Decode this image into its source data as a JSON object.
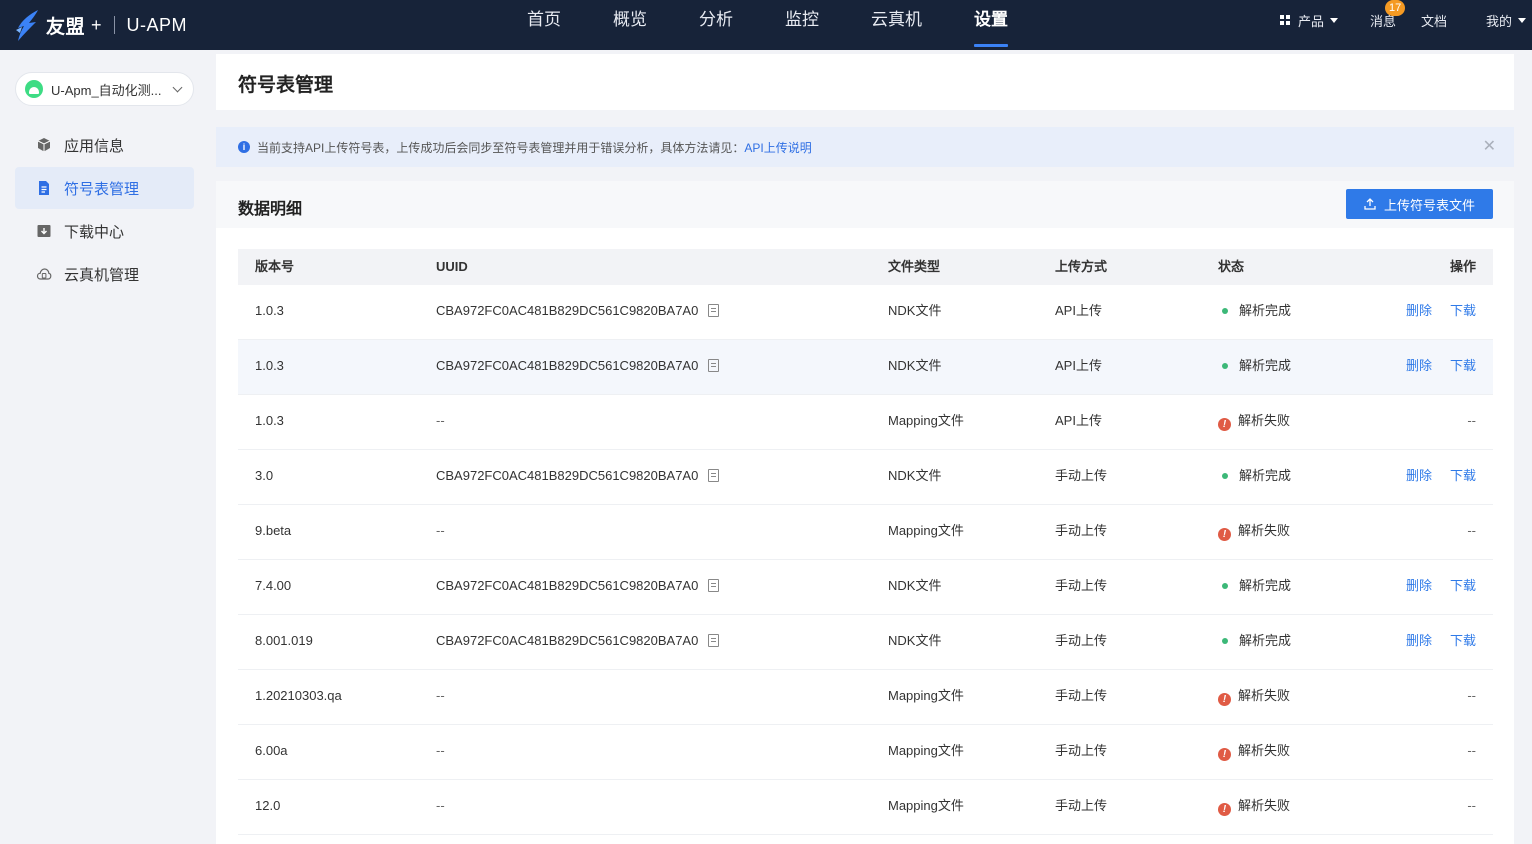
{
  "topnav": {
    "brand": "友盟",
    "brand_plus": "+",
    "product": "U-APM",
    "tabs": [
      "首页",
      "概览",
      "分析",
      "监控",
      "云真机",
      "设置"
    ],
    "active_tab": "设置",
    "right": {
      "products_label": "产品",
      "messages_label": "消息",
      "messages_badge": "17",
      "docs_label": "文档",
      "me_label": "我的"
    }
  },
  "sidebar": {
    "app_name": "U-Apm_自动化测...",
    "items": [
      {
        "label": "应用信息",
        "icon": "cube-icon"
      },
      {
        "label": "符号表管理",
        "icon": "document-icon"
      },
      {
        "label": "下载中心",
        "icon": "download-icon"
      },
      {
        "label": "云真机管理",
        "icon": "cloud-icon"
      }
    ],
    "active_index": 1
  },
  "page": {
    "title": "符号表管理",
    "banner_text": "当前支持API上传符号表，上传成功后会同步至符号表管理并用于错误分析，具体方法请见：",
    "banner_link": "API上传说明",
    "section_title": "数据明细",
    "upload_button": "上传符号表文件"
  },
  "table": {
    "headers": [
      "版本号",
      "UUID",
      "文件类型",
      "上传方式",
      "状态",
      "操作"
    ],
    "delete_label": "删除",
    "download_label": "下载",
    "rows": [
      {
        "version": "1.0.3",
        "uuid": "CBA972FC0AC481B829DC561C9820BA7A0",
        "type": "NDK文件",
        "method": "API上传",
        "status": "解析完成",
        "ok": true
      },
      {
        "version": "1.0.3",
        "uuid": "CBA972FC0AC481B829DC561C9820BA7A0",
        "type": "NDK文件",
        "method": "API上传",
        "status": "解析完成",
        "ok": true
      },
      {
        "version": "1.0.3",
        "uuid": "--",
        "type": "Mapping文件",
        "method": "API上传",
        "status": "解析失败",
        "ok": false
      },
      {
        "version": "3.0",
        "uuid": "CBA972FC0AC481B829DC561C9820BA7A0",
        "type": "NDK文件",
        "method": "手动上传",
        "status": "解析完成",
        "ok": true
      },
      {
        "version": "9.beta",
        "uuid": "--",
        "type": "Mapping文件",
        "method": "手动上传",
        "status": "解析失败",
        "ok": false
      },
      {
        "version": "7.4.00",
        "uuid": "CBA972FC0AC481B829DC561C9820BA7A0",
        "type": "NDK文件",
        "method": "手动上传",
        "status": "解析完成",
        "ok": true
      },
      {
        "version": "8.001.019",
        "uuid": "CBA972FC0AC481B829DC561C9820BA7A0",
        "type": "NDK文件",
        "method": "手动上传",
        "status": "解析完成",
        "ok": true
      },
      {
        "version": "1.20210303.qa",
        "uuid": "--",
        "type": "Mapping文件",
        "method": "手动上传",
        "status": "解析失败",
        "ok": false
      },
      {
        "version": "6.00a",
        "uuid": "--",
        "type": "Mapping文件",
        "method": "手动上传",
        "status": "解析失败",
        "ok": false
      },
      {
        "version": "12.0",
        "uuid": "--",
        "type": "Mapping文件",
        "method": "手动上传",
        "status": "解析失败",
        "ok": false
      }
    ]
  },
  "colors": {
    "nav_bg": "#172339",
    "accent": "#2f7ae8",
    "success": "#3cb878",
    "error": "#e05b45",
    "badge": "#f59a23"
  }
}
